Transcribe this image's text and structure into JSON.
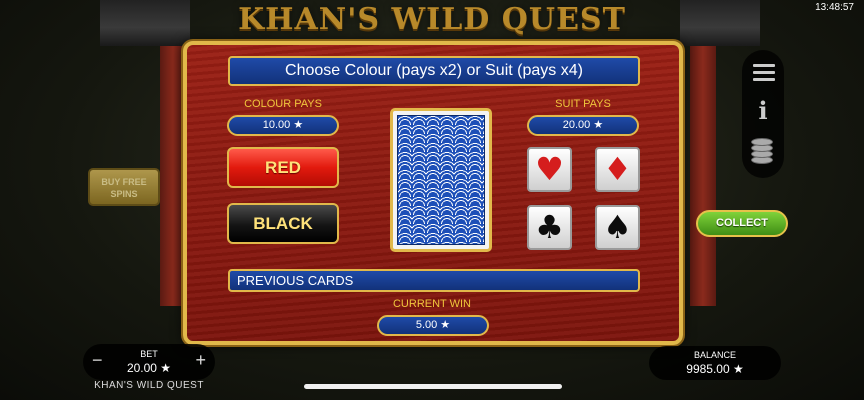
{
  "status_bar": {
    "time": "13:48:57"
  },
  "game": {
    "title": "KHAN'S WILD QUEST"
  },
  "gamble": {
    "header": "Choose Colour (pays x2) or Suit (pays x4)",
    "colour_pays_label": "COLOUR PAYS",
    "colour_pays_value": "10.00 ★",
    "suit_pays_label": "SUIT PAYS",
    "suit_pays_value": "20.00 ★",
    "red_label": "RED",
    "black_label": "BLACK",
    "suits": [
      {
        "name": "hearts",
        "glyph": "♥"
      },
      {
        "name": "diamonds",
        "glyph": "♦"
      },
      {
        "name": "clubs",
        "glyph": "♣"
      },
      {
        "name": "spades",
        "glyph": "♠"
      }
    ],
    "previous_cards_label": "PREVIOUS CARDS",
    "current_win_label": "CURRENT WIN",
    "current_win_value": "5.00 ★"
  },
  "side": {
    "buy_free_spins": "BUY FREE SPINS",
    "collect": "COLLECT",
    "menu_icons": [
      "hamburger-menu-icon",
      "info-icon",
      "coins-icon"
    ]
  },
  "bottom": {
    "bet_label": "BET",
    "bet_value": "20.00 ★",
    "bet_minus": "−",
    "bet_plus": "+",
    "game_name": "KHAN'S WILD QUEST",
    "balance_label": "BALANCE",
    "balance_value": "9985.00 ★"
  },
  "colors": {
    "panel_red": "#8b1a10",
    "gold_border": "#e1b84a",
    "bar_blue": "#1a3f95",
    "label_gold": "#f0c63c",
    "collect_green": "#5cb526"
  }
}
